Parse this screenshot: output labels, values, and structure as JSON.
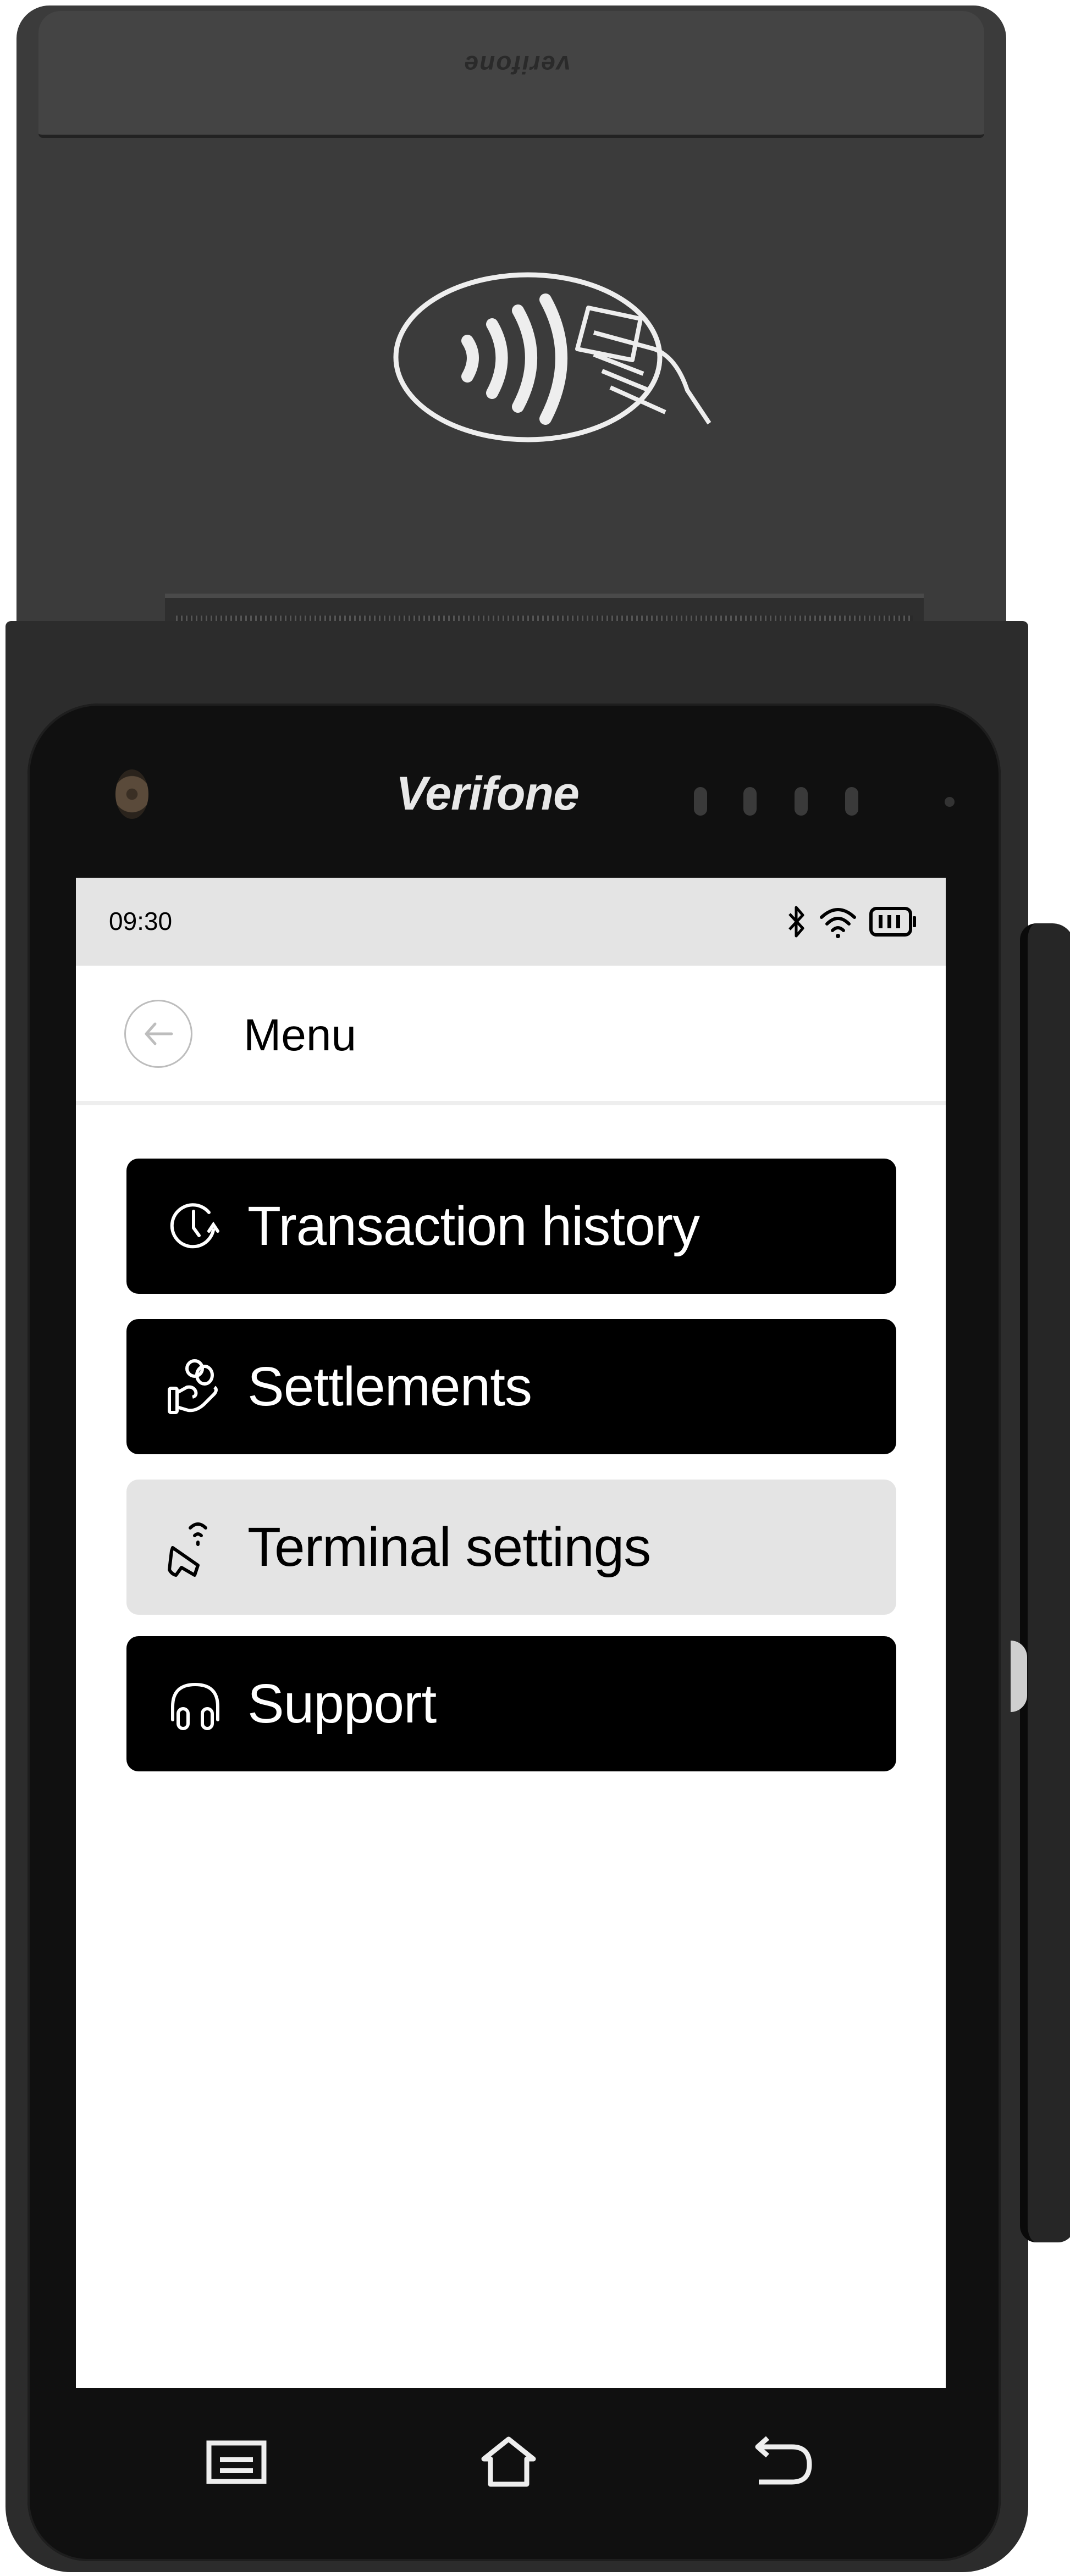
{
  "device": {
    "brand": "Verifone",
    "lid_brand": "verifone",
    "contactless_icon": "contactless-payment-icon"
  },
  "status_bar": {
    "time": "09:30",
    "icons": [
      "bluetooth-icon",
      "wifi-icon",
      "battery-icon"
    ]
  },
  "header": {
    "back_icon": "arrow-left-icon",
    "title": "Menu"
  },
  "menu": {
    "items": [
      {
        "label": "Transaction history",
        "icon": "clock-history-icon",
        "style": "dark"
      },
      {
        "label": "Settlements",
        "icon": "hand-coins-icon",
        "style": "dark"
      },
      {
        "label": "Terminal settings",
        "icon": "terminal-contactless-icon",
        "style": "highlighted"
      },
      {
        "label": "Support",
        "icon": "headset-icon",
        "style": "dark"
      }
    ]
  },
  "nav_bar": {
    "buttons": [
      {
        "name": "recent-apps",
        "icon": "recent-apps-icon"
      },
      {
        "name": "home",
        "icon": "home-icon"
      },
      {
        "name": "back",
        "icon": "back-arrow-icon"
      }
    ]
  },
  "colors": {
    "button_dark": "#000000",
    "button_highlight": "#e4e4e4",
    "status_bar": "#e4e4e4",
    "device_body": "#2c2c2c"
  }
}
